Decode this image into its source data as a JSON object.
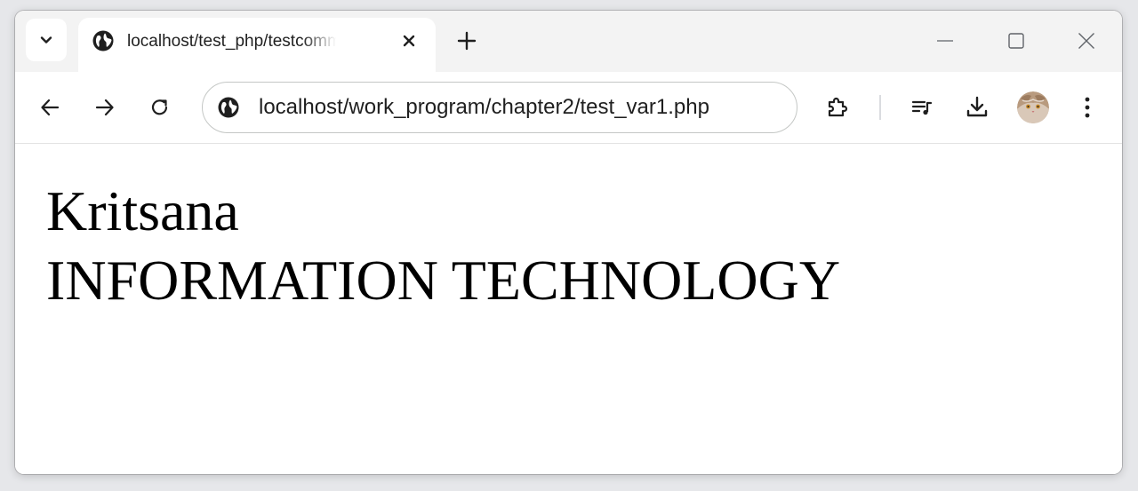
{
  "tabstrip": {
    "tab": {
      "title": "localhost/test_php/testcomment.php",
      "favicon": "globe-icon"
    },
    "search_tabs_icon": "chevron-down-icon",
    "new_tab_icon": "plus-icon"
  },
  "window_controls": [
    "minimize-icon",
    "maximize-icon",
    "close-icon"
  ],
  "toolbar": {
    "nav_icons": [
      "back-arrow-icon",
      "forward-arrow-icon",
      "reload-icon"
    ],
    "omnibox": {
      "site_icon": "site-info-icon",
      "url": "localhost/work_program/chapter2/test_var1.php"
    },
    "action_icons": [
      "extensions-icon",
      "reading-list-icon",
      "download-icon",
      "profile-avatar",
      "more-menu-icon"
    ]
  },
  "page": {
    "line1": "Kritsana",
    "line2": "INFORMATION TECHNOLOGY"
  },
  "colors": {
    "tabstrip_bg": "#f3f3f3",
    "toolbar_bg": "#ffffff",
    "text": "#1f1f1f",
    "omnibox_border": "#c4c7c5"
  }
}
